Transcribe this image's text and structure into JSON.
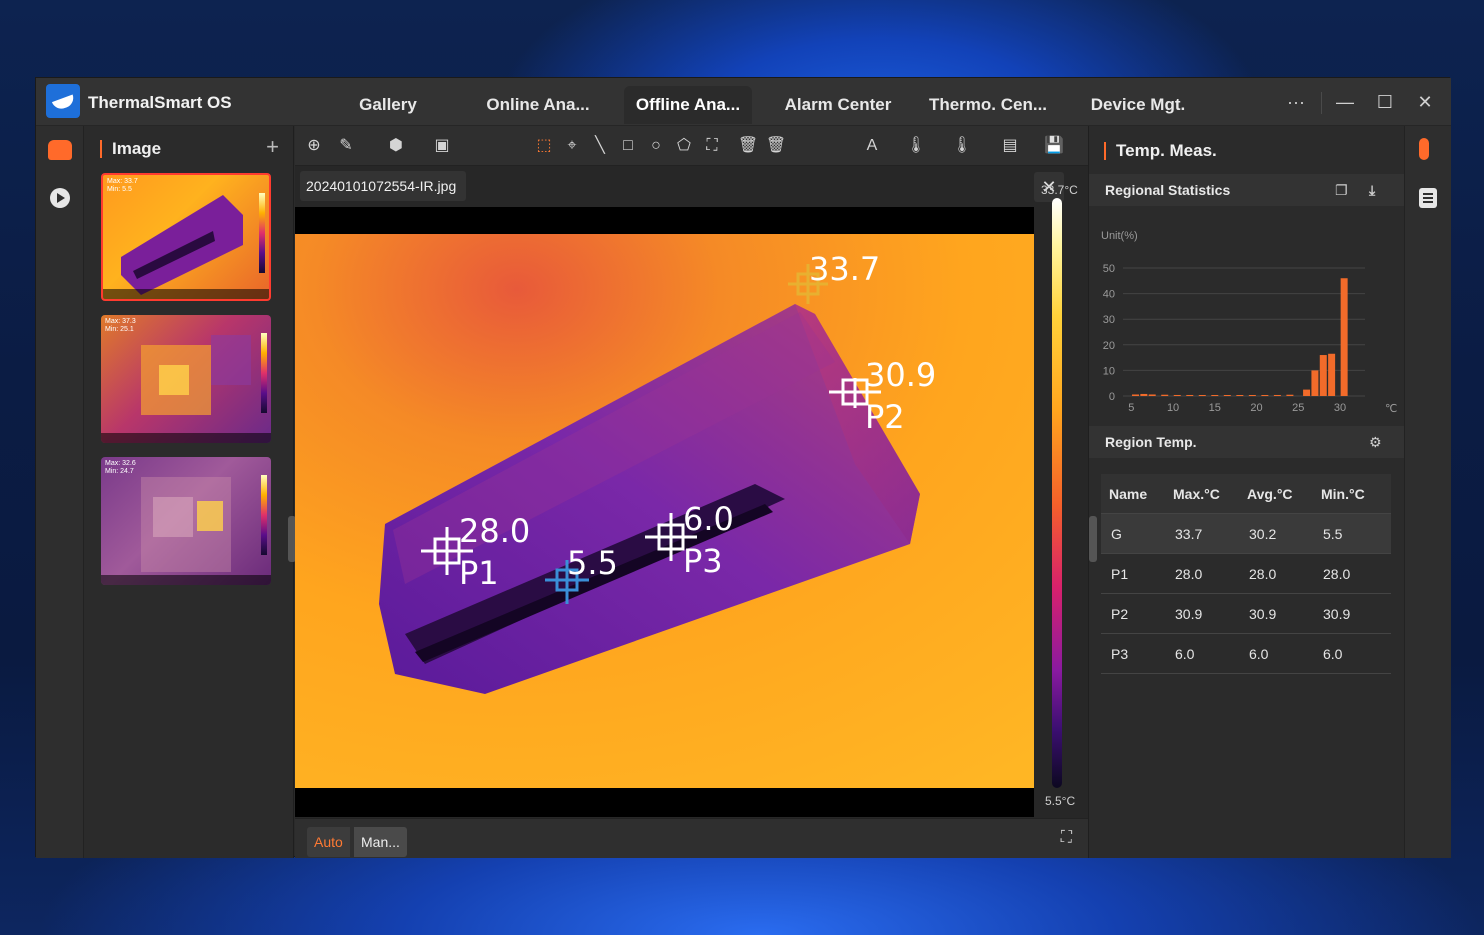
{
  "app": {
    "title": "ThermalSmart OS"
  },
  "tabs": [
    {
      "label": "Gallery"
    },
    {
      "label": "Online Ana..."
    },
    {
      "label": "Offline Ana...",
      "active": true
    },
    {
      "label": "Alarm Center"
    },
    {
      "label": "Thermo. Cen..."
    },
    {
      "label": "Device Mgt."
    }
  ],
  "window_controls": {
    "more": "···",
    "minimize": "—",
    "maximize": "☐",
    "close": "✕"
  },
  "image_panel": {
    "title": "Image",
    "add": "+",
    "thumbnails": [
      {
        "max": "Max: 33.7",
        "min": "Min: 5.5",
        "selected": true
      },
      {
        "max": "Max: 37.3",
        "min": "Min: 25.1",
        "selected": false
      },
      {
        "max": "Max: 32.6",
        "min": "Min: 24.7",
        "selected": false
      }
    ]
  },
  "viewer": {
    "filename": "20240101072554-IR.jpg",
    "scale_max": "33.7°C",
    "scale_min": "5.5°C",
    "mode_auto": "Auto",
    "mode_manual": "Man...",
    "markers": [
      {
        "label": "33.7",
        "name": ""
      },
      {
        "label": "30.9",
        "name": "P2"
      },
      {
        "label": "28.0",
        "name": "P1"
      },
      {
        "label": "5.5",
        "name": ""
      },
      {
        "label": "6.0",
        "name": "P3"
      }
    ]
  },
  "right_panel": {
    "title": "Temp. Meas.",
    "regional_statistics": "Regional Statistics",
    "unit": "Unit(%)",
    "region_temp": "Region Temp.",
    "table": {
      "headers": [
        "Name",
        "Max.°C",
        "Avg.°C",
        "Min.°C"
      ],
      "rows": [
        [
          "G",
          "33.7",
          "30.2",
          "5.5"
        ],
        [
          "P1",
          "28.0",
          "28.0",
          "28.0"
        ],
        [
          "P2",
          "30.9",
          "30.9",
          "30.9"
        ],
        [
          "P3",
          "6.0",
          "6.0",
          "6.0"
        ]
      ]
    }
  },
  "chart_data": {
    "type": "bar",
    "ylabel": "Unit(%)",
    "xlabel": "℃",
    "ylim": [
      0,
      50
    ],
    "yticks": [
      0,
      10,
      20,
      30,
      40,
      50
    ],
    "xticks": [
      5,
      10,
      15,
      20,
      25,
      30
    ],
    "bar_color": "#f26b2a",
    "bins": [
      {
        "x": 5.5,
        "value": 0.6
      },
      {
        "x": 6.5,
        "value": 0.8
      },
      {
        "x": 7.5,
        "value": 0.6
      },
      {
        "x": 9,
        "value": 0.5
      },
      {
        "x": 10.5,
        "value": 0.4
      },
      {
        "x": 12,
        "value": 0.4
      },
      {
        "x": 13.5,
        "value": 0.3
      },
      {
        "x": 15,
        "value": 0.3
      },
      {
        "x": 16.5,
        "value": 0.3
      },
      {
        "x": 18,
        "value": 0.3
      },
      {
        "x": 19.5,
        "value": 0.3
      },
      {
        "x": 21,
        "value": 0.3
      },
      {
        "x": 22.5,
        "value": 0.4
      },
      {
        "x": 24,
        "value": 0.5
      },
      {
        "x": 26,
        "value": 2.5
      },
      {
        "x": 27,
        "value": 10
      },
      {
        "x": 28,
        "value": 16
      },
      {
        "x": 29,
        "value": 16.5
      },
      {
        "x": 30.5,
        "value": 46
      }
    ]
  }
}
